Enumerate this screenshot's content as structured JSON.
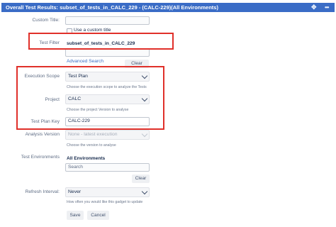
{
  "header": {
    "title": "Overall Test Results: subset_of_tests_in_CALC_229 - (CALC-229)(All Environments)",
    "move_icon": "move-icon",
    "menu_icon": "more-options-icon"
  },
  "form": {
    "custom_title": {
      "label": "Custom Title:",
      "value": "",
      "checkbox_label": "Use a custom title"
    },
    "test_filter": {
      "label": "Test Filter",
      "value": "subset_of_tests_in_CALC_229",
      "advanced_search_link": "Advanced Search",
      "clear_button": "Clear"
    },
    "execution_scope": {
      "label": "Execution Scope",
      "value": "Test Plan",
      "help": "Choose the execution scope to analyze the Tests"
    },
    "project": {
      "label": "Project",
      "value": "CALC",
      "help": "Choose the project Version to analyse"
    },
    "test_plan_key": {
      "label": "Test Plan Key",
      "value": "CALC-229"
    },
    "analysis_version": {
      "label": "Analysis Version",
      "value": "None - latest execution",
      "help": "Choose the version to analyse"
    },
    "test_environments": {
      "label": "Test Environments",
      "value": "All Environments",
      "search_placeholder": "Search",
      "clear_button": "Clear"
    },
    "refresh_interval": {
      "label": "Refresh Interval:",
      "value": "Never",
      "help": "How often you would like this gadget to update"
    },
    "save_button": "Save",
    "cancel_button": "Cancel"
  },
  "colors": {
    "header_bg": "#3a6cc6",
    "highlight": "#e0302a",
    "link": "#3b6fc6"
  }
}
